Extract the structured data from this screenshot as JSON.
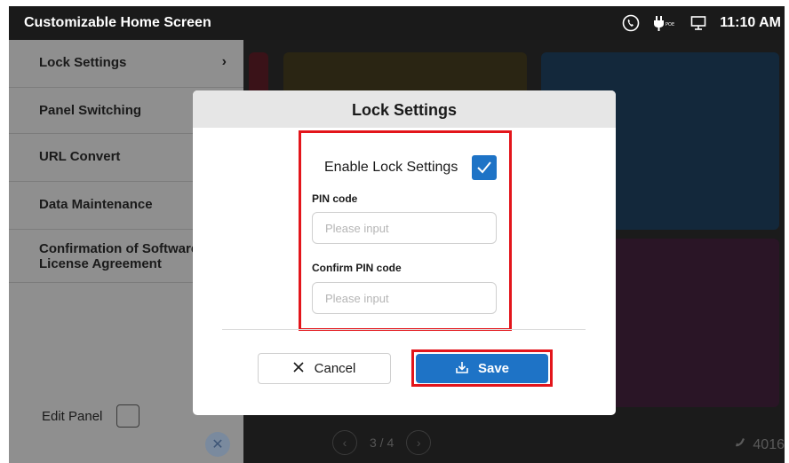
{
  "app": {
    "title": "Customizable Home Screen"
  },
  "status": {
    "time": "11:10 AM",
    "icons": [
      "phone-icon",
      "poe-power-icon",
      "desktop-monitor-icon"
    ],
    "poe_text": "POE"
  },
  "sidebar": {
    "items": [
      {
        "label": "Lock Settings",
        "has_chevron": true
      },
      {
        "label": "Panel Switching"
      },
      {
        "label": "URL Convert"
      },
      {
        "label": "Data Maintenance"
      },
      {
        "label": "Confirmation of Software License Agreement"
      }
    ],
    "edit_panel_label": "Edit Panel"
  },
  "modal": {
    "title": "Lock Settings",
    "enable_label": "Enable Lock Settings",
    "enable_checked": true,
    "pin_label": "PIN code",
    "pin_placeholder": "Please input",
    "confirm_label": "Confirm PIN code",
    "confirm_placeholder": "Please input",
    "cancel_label": "Cancel",
    "save_label": "Save"
  },
  "footer": {
    "page_indicator": "3 / 4",
    "extension": "4016"
  },
  "colors": {
    "accent": "#1e73c6",
    "highlight": "#e3151b",
    "panel_bg": "#8f8f8f",
    "screen_bg": "#1b1b1b"
  }
}
